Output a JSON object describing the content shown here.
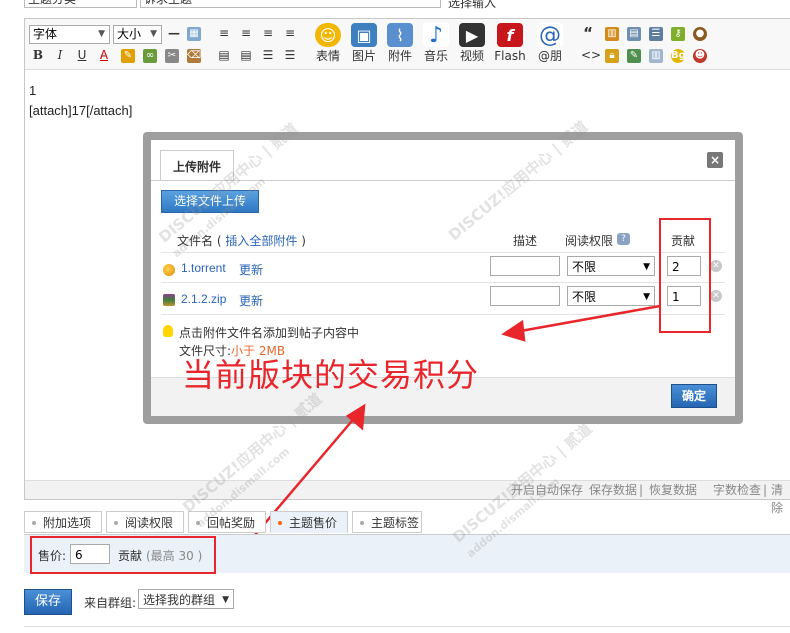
{
  "top_cutoff": {
    "field1": "主题分类",
    "field2": "诉求主题",
    "field3": "选择输入"
  },
  "toolbar": {
    "font_select": "字体",
    "size_select": "大小",
    "bold": "B",
    "italic": "I",
    "underline": "U",
    "color": "A",
    "buttons": [
      {
        "label": "表情",
        "icon": "smiley-icon"
      },
      {
        "label": "图片",
        "icon": "image-icon"
      },
      {
        "label": "附件",
        "icon": "paperclip-icon"
      },
      {
        "label": "音乐",
        "icon": "music-note-icon"
      },
      {
        "label": "视频",
        "icon": "video-icon"
      },
      {
        "label": "Flash",
        "icon": "flash-icon"
      },
      {
        "label": "@朋",
        "icon": "at-icon"
      }
    ],
    "quote_glyph": "“",
    "code_glyph": "<>"
  },
  "editor": {
    "line1": "1",
    "line2": "[attach]17[/attach]"
  },
  "statusbar": {
    "autosave": "开启自动保存",
    "save_data": "保存数据",
    "restore_data": "恢复数据",
    "word_check": "字数检查",
    "clear": "清除",
    "sep": "|"
  },
  "dialog": {
    "tab_label": "上传附件",
    "close_glyph": "×",
    "upload_button": "选择文件上传",
    "headers": {
      "filename": "文件名",
      "insert_all": "插入全部附件",
      "paren_open": "(",
      "paren_close": ")",
      "description": "描述",
      "read_permission": "阅读权限",
      "contribution": "贡献"
    },
    "files": [
      {
        "name": "1.torrent",
        "renew": "更新",
        "description": "",
        "permission": "不限",
        "contribution": "2"
      },
      {
        "name": "2.1.2.zip",
        "renew": "更新",
        "description": "",
        "permission": "不限",
        "contribution": "1"
      }
    ],
    "tip": "点击附件文件名添加到帖子内容中",
    "size_label": "文件尺寸:",
    "size_value": "小于 2MB",
    "ok_button": "确定"
  },
  "annotation": {
    "text": "当前版块的交易积分",
    "color": "#e8262c"
  },
  "tabs": [
    {
      "label": "附加选项",
      "active": false
    },
    {
      "label": "阅读权限",
      "active": false
    },
    {
      "label": "回帖奖励",
      "active": false
    },
    {
      "label": "主题售价",
      "active": true
    },
    {
      "label": "主题标签",
      "active": false
    }
  ],
  "price": {
    "label": "售价:",
    "value": "6",
    "unit": "贡献",
    "max_note": "(最高 30 )"
  },
  "footer": {
    "save_button": "保存",
    "group_label": "来自群组:",
    "group_select": "选择我的群组"
  },
  "watermark": {
    "text": "DISCUZ!应用中心 | 贰道",
    "url": "addon.dismall.com"
  },
  "colors": {
    "accent_blue": "#2f78c4",
    "link": "#2a64b8",
    "annotation_red": "#e8262c",
    "panel_bg": "#eaf1f8"
  }
}
